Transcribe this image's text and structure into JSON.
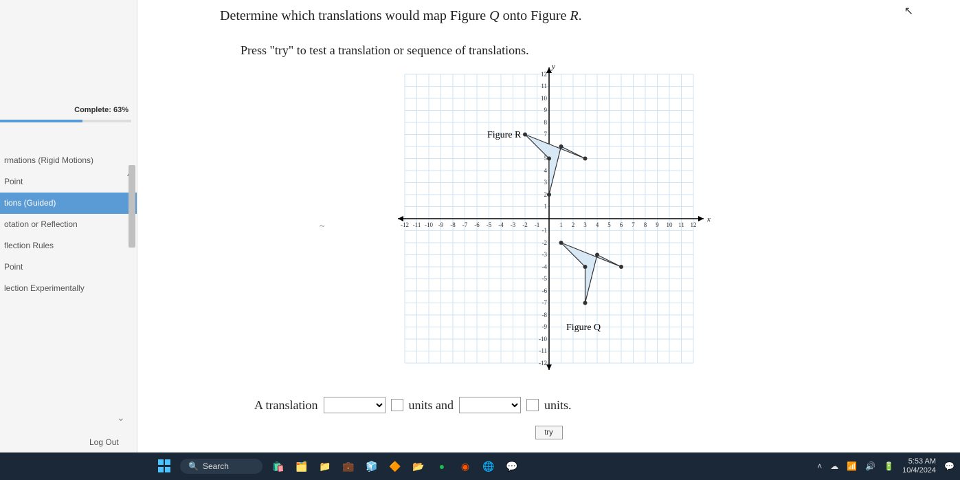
{
  "question": "Determine which translations would map Figure Q onto Figure R.",
  "instruction": "Press \"try\" to test a translation or sequence of translations.",
  "sidebar": {
    "complete_label": "Complete: 63%",
    "items": [
      {
        "label": "rmations (Rigid Motions)"
      },
      {
        "label": "Point"
      },
      {
        "label": "tions (Guided)"
      },
      {
        "label": "otation or Reflection"
      },
      {
        "label": "flection Rules"
      },
      {
        "label": "Point"
      },
      {
        "label": "lection Experimentally"
      }
    ],
    "logout": "Log Out"
  },
  "answer": {
    "prefix": "A translation",
    "mid": "units and",
    "suffix": "units."
  },
  "try_label": "try",
  "chart_data": {
    "type": "scatter",
    "title": "",
    "xlabel": "x",
    "ylabel": "y",
    "xlim": [
      -12,
      12
    ],
    "ylim": [
      -12,
      12
    ],
    "figures": [
      {
        "name": "Figure R",
        "label_pos": [
          -3.5,
          7
        ],
        "vertices": [
          [
            -2,
            7
          ],
          [
            0,
            5
          ],
          [
            0,
            2
          ],
          [
            1,
            6
          ],
          [
            3,
            5
          ]
        ]
      },
      {
        "name": "Figure Q",
        "label_pos": [
          4,
          -9
        ],
        "vertices": [
          [
            1,
            -2
          ],
          [
            3,
            -4
          ],
          [
            3,
            -7
          ],
          [
            4,
            -3
          ],
          [
            6,
            -4
          ]
        ]
      }
    ]
  },
  "taskbar": {
    "search_placeholder": "Search",
    "time": "5:53 AM",
    "date": "10/4/2024"
  }
}
